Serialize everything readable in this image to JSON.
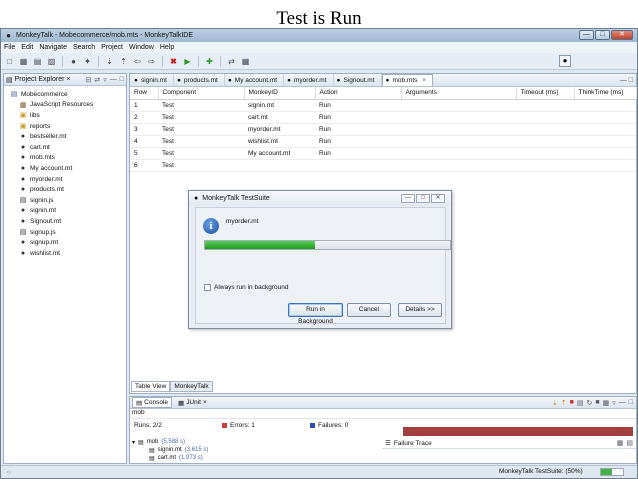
{
  "slide_title": "Test is Run",
  "window": {
    "title": "MonkeyTalk - Mobecommerce/mob.mts - MonkeyTalkIDE"
  },
  "menu": [
    "File",
    "Edit",
    "Navigate",
    "Search",
    "Project",
    "Window",
    "Help"
  ],
  "project_explorer": {
    "tab_label": "Project Explorer",
    "tree": [
      {
        "label": "Mobecommerce",
        "icon": "project-icon",
        "level": 0
      },
      {
        "label": "JavaScript Resources",
        "icon": "library-icon",
        "level": 1
      },
      {
        "label": "libs",
        "icon": "folder-icon",
        "level": 1
      },
      {
        "label": "reports",
        "icon": "folder-icon",
        "level": 1
      },
      {
        "label": "bestseller.mt",
        "icon": "monkey-file-icon",
        "level": 1
      },
      {
        "label": "cart.mt",
        "icon": "monkey-file-icon",
        "level": 1
      },
      {
        "label": "mob.mts",
        "icon": "monkey-file-icon",
        "level": 1
      },
      {
        "label": "My account.mt",
        "icon": "monkey-file-icon",
        "level": 1
      },
      {
        "label": "myorder.mt",
        "icon": "monkey-file-icon",
        "level": 1
      },
      {
        "label": "products.mt",
        "icon": "monkey-file-icon",
        "level": 1
      },
      {
        "label": "signin.js",
        "icon": "js-file-icon",
        "level": 1
      },
      {
        "label": "signin.mt",
        "icon": "monkey-file-icon",
        "level": 1
      },
      {
        "label": "Signout.mt",
        "icon": "monkey-file-icon",
        "level": 1
      },
      {
        "label": "signup.js",
        "icon": "js-file-icon",
        "level": 1
      },
      {
        "label": "signup.mt",
        "icon": "monkey-file-icon",
        "level": 1
      },
      {
        "label": "wishlist.mt",
        "icon": "monkey-file-icon",
        "level": 1
      }
    ]
  },
  "editor": {
    "tabs": [
      {
        "label": "signin.mt",
        "active": false
      },
      {
        "label": "products.mt",
        "active": false
      },
      {
        "label": "My account.mt",
        "active": false
      },
      {
        "label": "myorder.mt",
        "active": false
      },
      {
        "label": "Signout.mt",
        "active": false
      },
      {
        "label": "mob.mts",
        "active": true
      }
    ],
    "columns": [
      "Row",
      "Component",
      "MonkeyID",
      "Action",
      "Arguments",
      "Timeout (ms)",
      "ThinkTime (ms)"
    ],
    "rows": [
      {
        "row": "1",
        "component": "Test",
        "monkey_id": "signin.mt",
        "action": "Run"
      },
      {
        "row": "2",
        "component": "Test",
        "monkey_id": "cart.mt",
        "action": "Run"
      },
      {
        "row": "3",
        "component": "Test",
        "monkey_id": "myorder.mt",
        "action": "Run"
      },
      {
        "row": "4",
        "component": "Test",
        "monkey_id": "wishlist.mt",
        "action": "Run"
      },
      {
        "row": "5",
        "component": "Test",
        "monkey_id": "My account.mt",
        "action": "Run"
      },
      {
        "row": "6",
        "component": "Test",
        "monkey_id": "",
        "action": ""
      }
    ],
    "bottom_tabs": [
      "Table View",
      "MonkeyTalk"
    ]
  },
  "dialog": {
    "title": "MonkeyTalk TestSuite",
    "message": "myorder.mt",
    "progress": 0.45,
    "checkbox_label": "Always run in background",
    "buttons": {
      "background": "Run in Background",
      "cancel": "Cancel",
      "details": "Details >>"
    }
  },
  "console": {
    "tabs": [
      "Console",
      "JUnit"
    ],
    "label": "mob",
    "runs": "Runs: 2/2",
    "errors": "Errors: 1",
    "failures": "Failures: 0",
    "failure_bar_color": "#a23e3e",
    "results": [
      {
        "name": "mob",
        "time": "(5.588 s)",
        "level": 0
      },
      {
        "name": "signin.mt",
        "time": "(3.615 s)",
        "level": 1
      },
      {
        "name": "cart.mt",
        "time": "(1.973 s)",
        "level": 1
      }
    ],
    "failure_trace_label": "Failure Trace"
  },
  "statusbar": {
    "right_text": "MonkeyTalk TestSuite: (50%)",
    "progress": 0.5
  }
}
